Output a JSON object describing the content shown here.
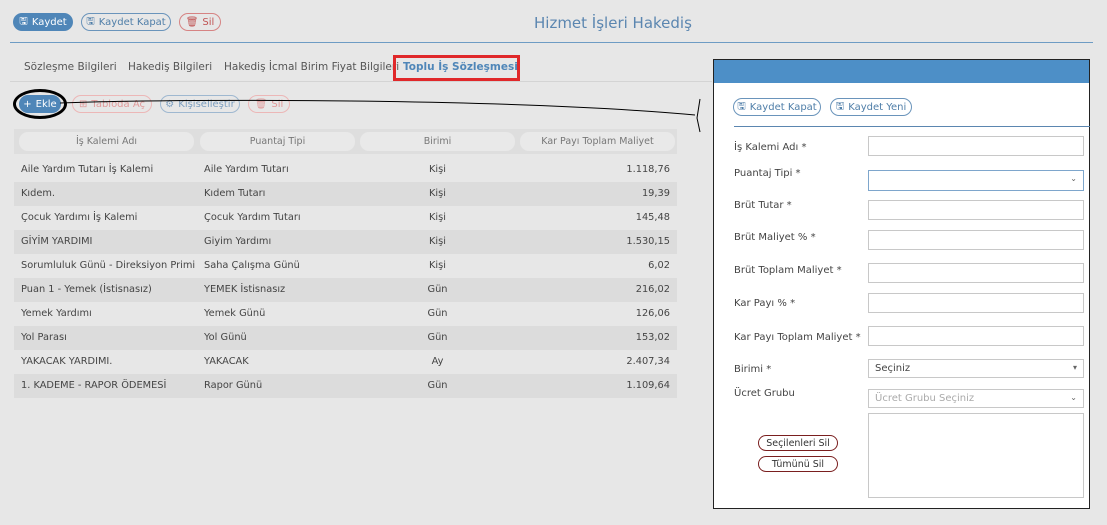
{
  "toolbar": {
    "save_label": "Kaydet",
    "save_close_label": "Kaydet Kapat",
    "delete_label": "Sil"
  },
  "page": {
    "title": "Hizmet İşleri Hakediş"
  },
  "tabs": [
    {
      "label": "Sözleşme Bilgileri"
    },
    {
      "label": "Hakediş Bilgileri"
    },
    {
      "label": "Hakediş İcmal Birim Fiyat Bilgileri"
    },
    {
      "label": "Toplu İş Sözleşmesi"
    }
  ],
  "actions": {
    "add_label": "Ekle",
    "open_in_table_label": "Tabloda Aç",
    "customize_label": "Kişiselleştir",
    "delete_label": "Sil"
  },
  "table": {
    "columns": [
      "İş Kalemi Adı",
      "Puantaj Tipi",
      "Birimi",
      "Kar Payı Toplam Maliyet"
    ],
    "rows": [
      [
        "Aile Yardım Tutarı İş Kalemi",
        "Aile Yardım Tutarı",
        "Kişi",
        "1.118,76"
      ],
      [
        "Kıdem.",
        "Kıdem Tutarı",
        "Kişi",
        "19,39"
      ],
      [
        "Çocuk Yardımı İş Kalemi",
        "Çocuk Yardım Tutarı",
        "Kişi",
        "145,48"
      ],
      [
        "GİYİM YARDIMI",
        "Giyim Yardımı",
        "Kişi",
        "1.530,15"
      ],
      [
        "Sorumluluk Günü - Direksiyon Primi",
        "Saha Çalışma Günü",
        "Kişi",
        "6,02"
      ],
      [
        "Puan 1 - Yemek (İstisnasız)",
        "YEMEK İstisnasız",
        "Gün",
        "216,02"
      ],
      [
        "Yemek Yardımı",
        "Yemek Günü",
        "Gün",
        "126,06"
      ],
      [
        "Yol Parası",
        "Yol Günü",
        "Gün",
        "153,02"
      ],
      [
        "YAKACAK YARDIMI.",
        "YAKACAK",
        "Ay",
        "2.407,34"
      ],
      [
        "1. KADEME - RAPOR ÖDEMESİ",
        "Rapor Günü",
        "Gün",
        "1.109,64"
      ]
    ]
  },
  "panel": {
    "save_close_label": "Kaydet Kapat",
    "save_new_label": "Kaydet Yeni",
    "fields": {
      "item_name": "İş Kalemi Adı *",
      "timesheet_type": "Puantaj Tipi *",
      "gross_amount": "Brüt Tutar *",
      "gross_cost_pct": "Brüt Maliyet % *",
      "gross_total_cost": "Brüt Toplam Maliyet *",
      "profit_pct": "Kar Payı % *",
      "profit_total_cost": "Kar Payı Toplam Maliyet *",
      "unit": "Birimi *",
      "fee_group": "Ücret Grubu"
    },
    "unit_value": "Seçiniz",
    "fee_group_placeholder": "Ücret Grubu Seçiniz",
    "delete_selected_label": "Seçilenleri Sil",
    "delete_all_label": "Tümünü Sil"
  },
  "colors": {
    "accent": "#4f86b8",
    "panel_header": "#4d8fc7",
    "highlight": "#e0282a"
  }
}
